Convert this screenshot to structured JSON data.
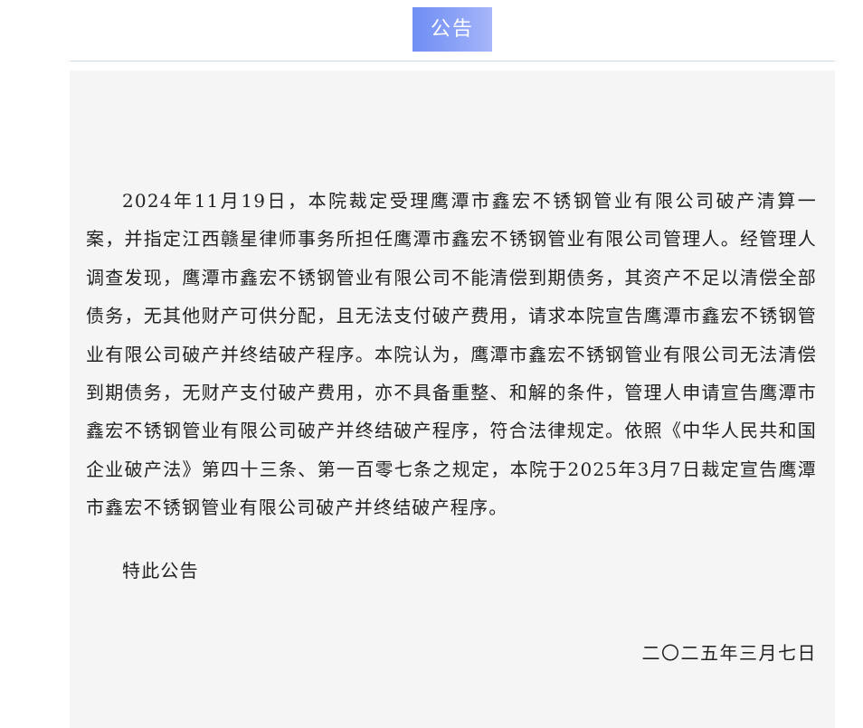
{
  "header": {
    "tab_label": "公告"
  },
  "notice": {
    "body": "2024年11月19日，本院裁定受理鹰潭市鑫宏不锈钢管业有限公司破产清算一案，并指定江西赣星律师事务所担任鹰潭市鑫宏不锈钢管业有限公司管理人。经管理人调查发现，鹰潭市鑫宏不锈钢管业有限公司不能清偿到期债务，其资产不足以清偿全部债务，无其他财产可供分配，且无法支付破产费用，请求本院宣告鹰潭市鑫宏不锈钢管业有限公司破产并终结破产程序。本院认为，鹰潭市鑫宏不锈钢管业有限公司无法清偿到期债务，无财产支付破产费用，亦不具备重整、和解的条件，管理人申请宣告鹰潭市鑫宏不锈钢管业有限公司破产并终结破产程序，符合法律规定。依照《中华人民共和国企业破产法》第四十三条、第一百零七条之规定，本院于2025年3月7日裁定宣告鹰潭市鑫宏不锈钢管业有限公司破产并终结破产程序。",
    "closing": "特此公告",
    "date": "二〇二五年三月七日"
  },
  "colors": {
    "tab_background": "#7f98f5",
    "divider": "#c9dbe6",
    "content_background": "#f5f5f5",
    "text": "#222222"
  }
}
